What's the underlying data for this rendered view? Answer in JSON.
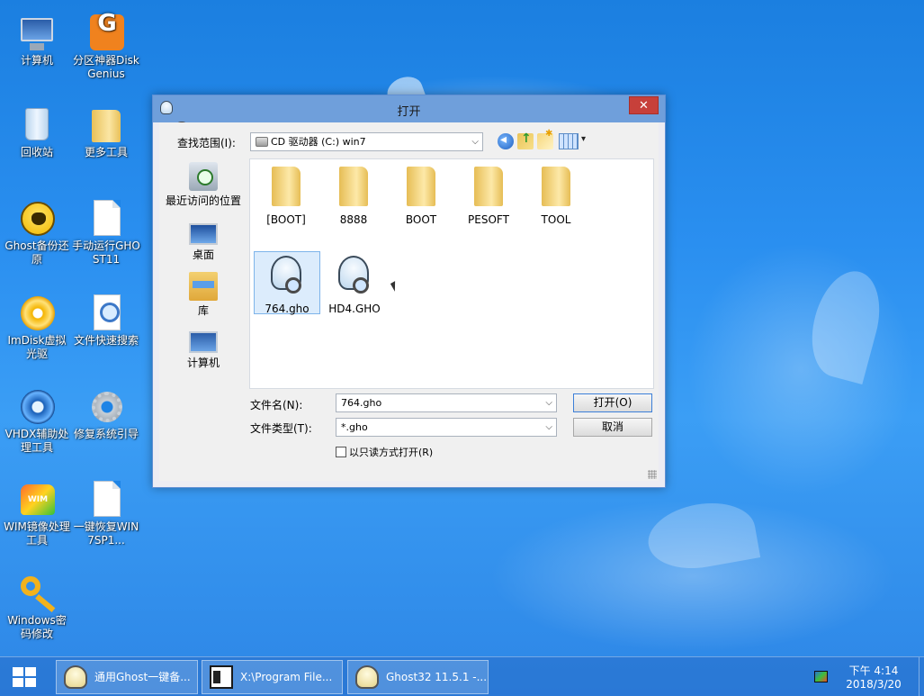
{
  "desktop": {
    "icons": [
      {
        "label": "计算机",
        "icon": "computer-icon"
      },
      {
        "label": "分区神器DiskGenius",
        "icon": "diskgenius-icon"
      },
      {
        "label": "回收站",
        "icon": "recycle-bin-icon"
      },
      {
        "label": "更多工具",
        "icon": "folder-icon"
      },
      {
        "label": "Ghost备份还原",
        "icon": "ghost-icon"
      },
      {
        "label": "手动运行GHOST11",
        "icon": "document-icon"
      },
      {
        "label": "ImDisk虚拟光驱",
        "icon": "disc-icon"
      },
      {
        "label": "文件快速搜索",
        "icon": "file-search-icon"
      },
      {
        "label": "VHDX辅助处理工具",
        "icon": "vhdx-icon"
      },
      {
        "label": "修复系统引导",
        "icon": "gear-icon"
      },
      {
        "label": "WIM镜像处理工具",
        "icon": "wim-icon"
      },
      {
        "label": "一键恢复WIN7SP1...",
        "icon": "document-icon"
      },
      {
        "label": "Windows密码修改",
        "icon": "key-icon"
      }
    ]
  },
  "dialog": {
    "title": "打开",
    "close_label": "✕",
    "look_in_label": "查找范围(I):",
    "look_in_value": "CD 驱动器 (C:) win7",
    "places": [
      {
        "label": "最近访问的位置",
        "icon": "recent-places-icon"
      },
      {
        "label": "桌面",
        "icon": "desktop-icon"
      },
      {
        "label": "库",
        "icon": "libraries-icon"
      },
      {
        "label": "计算机",
        "icon": "computer-icon"
      }
    ],
    "files": [
      {
        "name": "[BOOT]",
        "type": "folder",
        "selected": false
      },
      {
        "name": "8888",
        "type": "folder",
        "selected": false
      },
      {
        "name": "BOOT",
        "type": "folder",
        "selected": false
      },
      {
        "name": "PESOFT",
        "type": "folder",
        "selected": false
      },
      {
        "name": "TOOL",
        "type": "folder",
        "selected": false
      },
      {
        "name": "764.gho",
        "type": "ghost-image",
        "selected": true
      },
      {
        "name": "HD4.GHO",
        "type": "ghost-image",
        "selected": false
      }
    ],
    "filename_label": "文件名(N):",
    "filename_value": "764.gho",
    "filetype_label": "文件类型(T):",
    "filetype_value": "*.gho",
    "readonly_label": "以只读方式打开(R)",
    "open_button": "打开(O)",
    "cancel_button": "取消"
  },
  "taskbar": {
    "tasks": [
      {
        "label": "通用Ghost一键备...",
        "icon": "ghost-icon"
      },
      {
        "label": "X:\\Program File...",
        "icon": "console-icon"
      },
      {
        "label": "Ghost32 11.5.1 -...",
        "icon": "ghost-icon"
      }
    ],
    "clock_time": "下午 4:14",
    "clock_date": "2018/3/20"
  }
}
